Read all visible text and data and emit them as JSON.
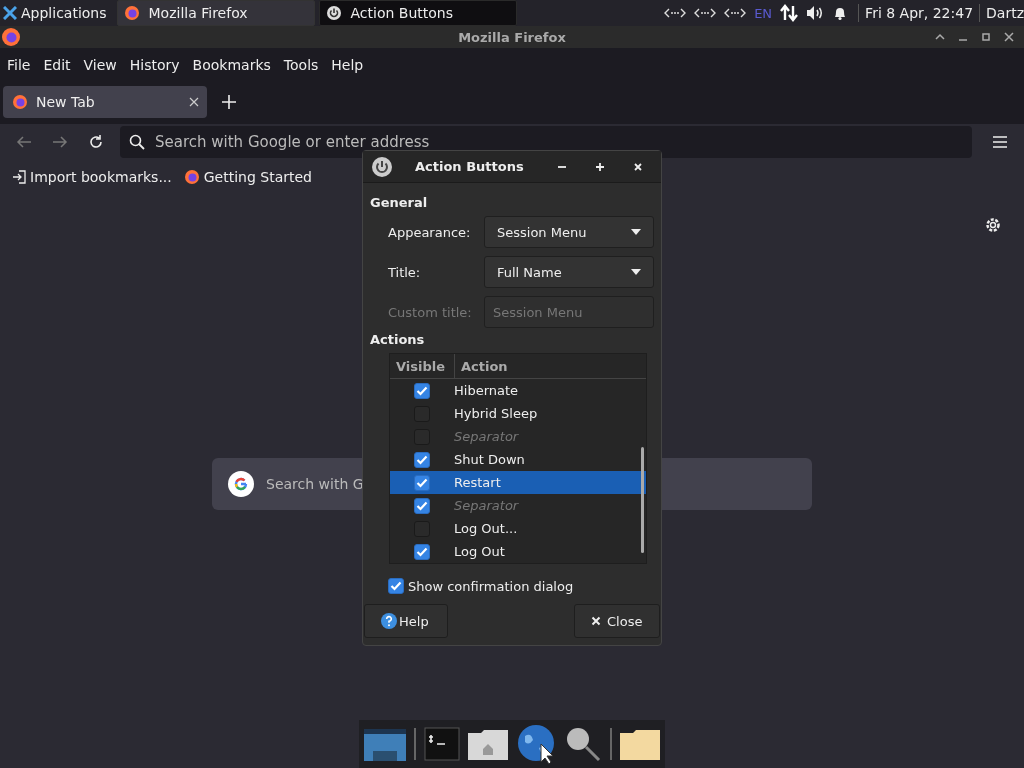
{
  "panel": {
    "launcher": "Applications",
    "tasks": [
      {
        "label": "Mozilla Firefox",
        "selected": false
      },
      {
        "label": "Action Buttons",
        "selected": true
      }
    ],
    "keyboard": "EN",
    "clock": "Fri  8 Apr, 22:47",
    "user": "Dartz"
  },
  "firefox": {
    "title": "Mozilla Firefox",
    "menu": [
      "File",
      "Edit",
      "View",
      "History",
      "Bookmarks",
      "Tools",
      "Help"
    ],
    "tabs": [
      {
        "label": "New Tab",
        "selected": true
      }
    ],
    "address": {
      "placeholder": "Search with Google or enter address"
    },
    "bookmarks": [
      {
        "label": "Import bookmarks...",
        "kind": "import"
      },
      {
        "label": "Getting Started",
        "kind": "firefox"
      }
    ],
    "page_search": {
      "placeholder": "Search with G"
    }
  },
  "dialog": {
    "title": "Action Buttons",
    "general": {
      "heading": "General",
      "fields": [
        {
          "label": "Appearance:",
          "value": "Session Menu",
          "kind": "dropdown",
          "disabled": false
        },
        {
          "label": "Title:",
          "value": "Full Name",
          "kind": "dropdown",
          "disabled": false
        },
        {
          "label": "Custom title:",
          "placeholder": "Session Menu",
          "kind": "text",
          "disabled": true
        }
      ]
    },
    "actions": {
      "heading": "Actions",
      "columns": [
        "Visible",
        "Action"
      ],
      "rows": [
        {
          "label": "Hibernate",
          "visible": true,
          "selected": false,
          "kind": "action"
        },
        {
          "label": "Hybrid Sleep",
          "visible": false,
          "selected": false,
          "kind": "action"
        },
        {
          "label": "Separator",
          "visible": false,
          "selected": false,
          "kind": "separator"
        },
        {
          "label": "Shut Down",
          "visible": true,
          "selected": false,
          "kind": "action"
        },
        {
          "label": "Restart",
          "visible": true,
          "selected": true,
          "kind": "action"
        },
        {
          "label": "Separator",
          "visible": true,
          "selected": false,
          "kind": "separator"
        },
        {
          "label": "Log Out...",
          "visible": false,
          "selected": false,
          "kind": "action"
        },
        {
          "label": "Log Out",
          "visible": true,
          "selected": false,
          "kind": "action"
        }
      ]
    },
    "confirmation": {
      "label": "Show confirmation dialog",
      "checked": true
    },
    "help_button": "Help",
    "close_button": "Close"
  }
}
